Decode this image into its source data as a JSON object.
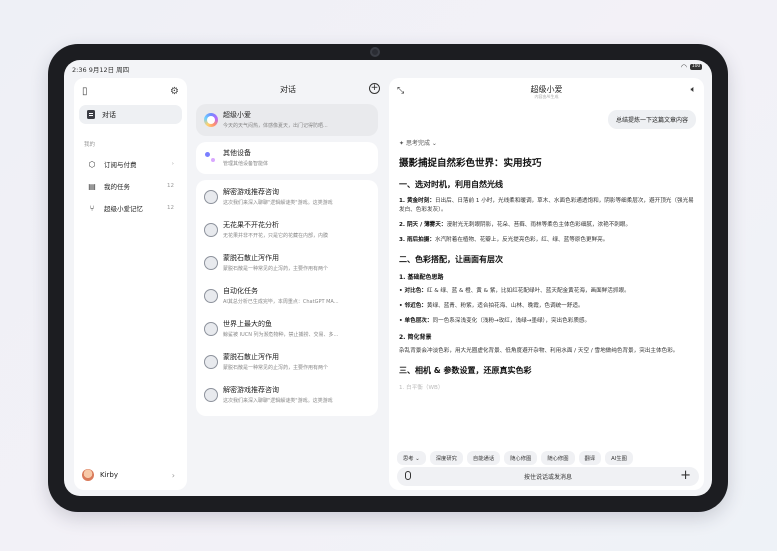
{
  "status": {
    "time": "2:36",
    "date": "9月12日 周四",
    "battery": "100"
  },
  "sidebar": {
    "active_item": "对话",
    "section_label": "我的",
    "items": [
      {
        "label": "订阅与付费",
        "count": ""
      },
      {
        "label": "我的任务",
        "count": "12"
      },
      {
        "label": "超级小爱记忆",
        "count": "12"
      }
    ],
    "user": {
      "name": "Kirby"
    }
  },
  "conversations": {
    "title": "对话",
    "pinned": [
      {
        "title": "超级小爱",
        "subtitle": "今天的天气闷热，体感像夏天，出门记得防晒..."
      },
      {
        "title": "其他设备",
        "subtitle": "管理其他设备智能体"
      }
    ],
    "list": [
      {
        "title": "解密游戏推荐咨询",
        "subtitle": "这次我们来深入聊聊\"逻辑解谜类\"游戏。这类游戏"
      },
      {
        "title": "无花果不开花分析",
        "subtitle": "无花果并非不开花，只是它的花藏在内部，内膜"
      },
      {
        "title": "蒙脱石散止泻作用",
        "subtitle": "蒙脱石散是一种常见的止泻药，主要作用有两个"
      },
      {
        "title": "自动化任务",
        "subtitle": "AI其总分析已生成完毕，本周重点：ChatGPT MA..."
      },
      {
        "title": "世界上最大的鱼",
        "subtitle": "鲸鲨被 IUCN 列为濒危物种，禁止捕捞、交易、多..."
      },
      {
        "title": "蒙脱石散止泻作用",
        "subtitle": "蒙脱石散是一种常见的止泻药，主要作用有两个"
      },
      {
        "title": "解密游戏推荐咨询",
        "subtitle": "这次我们来深入聊聊\"逻辑解谜类\"游戏。这类游戏"
      }
    ]
  },
  "chat": {
    "title": "超级小爱",
    "subtitle": "内容由AI生成",
    "user_message": "总结提炼一下这篇文章内容",
    "thinking": "思考完成",
    "article": {
      "title": "摄影捕捉自然彩色世界：实用技巧",
      "s1_title": "一、选对时机，利用自然光线",
      "s1_items": [
        {
          "label": "1. 黄金时刻：",
          "text": "日出后、日落前 1 小时，光线柔和暖调，草木、水面色彩通透饱和，阴影等细柔层次，避开顶光（强光易发白、色彩发灰）。"
        },
        {
          "label": "2. 阴天 / 薄雾天：",
          "text": "漫射光无刺眼阴影，花朵、苔藓、雨林等柔色主体色彩细腻，浓艳不刺眼。"
        },
        {
          "label": "3. 雨后拍摄：",
          "text": "水汽附着在植物、花瓣上，反光提亮色彩，红、绿、蓝等原色更鲜亮。"
        }
      ],
      "s2_title": "二、色彩搭配，让画面有层次",
      "s2_sub1": "1. 基础配色思路",
      "s2_items": [
        {
          "label": "• 对比色：",
          "text": "红 & 绿、蓝 & 橙、黄 & 紫，比如红花配绿叶、蓝天配金黄花海，画面鲜活抓眼。"
        },
        {
          "label": "• 邻近色：",
          "text": "黄绿、蓝青、粉紫，适合拍花海、山林、晚霞，色调统一舒适。"
        },
        {
          "label": "• 单色层次：",
          "text": "同一色系深浅变化（浅粉→玫红，浅绿→墨绿），突出色彩质感。"
        }
      ],
      "s2_sub2": "2. 简化背景",
      "s2_p": "杂乱背景会冲淡色彩，用大光圈虚化背景、低角度避开杂物、利用水面 / 天空 / 雪地做纯色背景，突出主体色彩。",
      "s3_title": "三、相机 & 参数设置，还原真实色彩",
      "s3_faded": "1. 白平衡（WB）"
    },
    "chips": [
      "思考 ⌄",
      "深度研究",
      "自能通话",
      "随心修图",
      "随心修图",
      "翻译",
      "AI生图"
    ],
    "input_placeholder": "按住说话或发消息"
  }
}
